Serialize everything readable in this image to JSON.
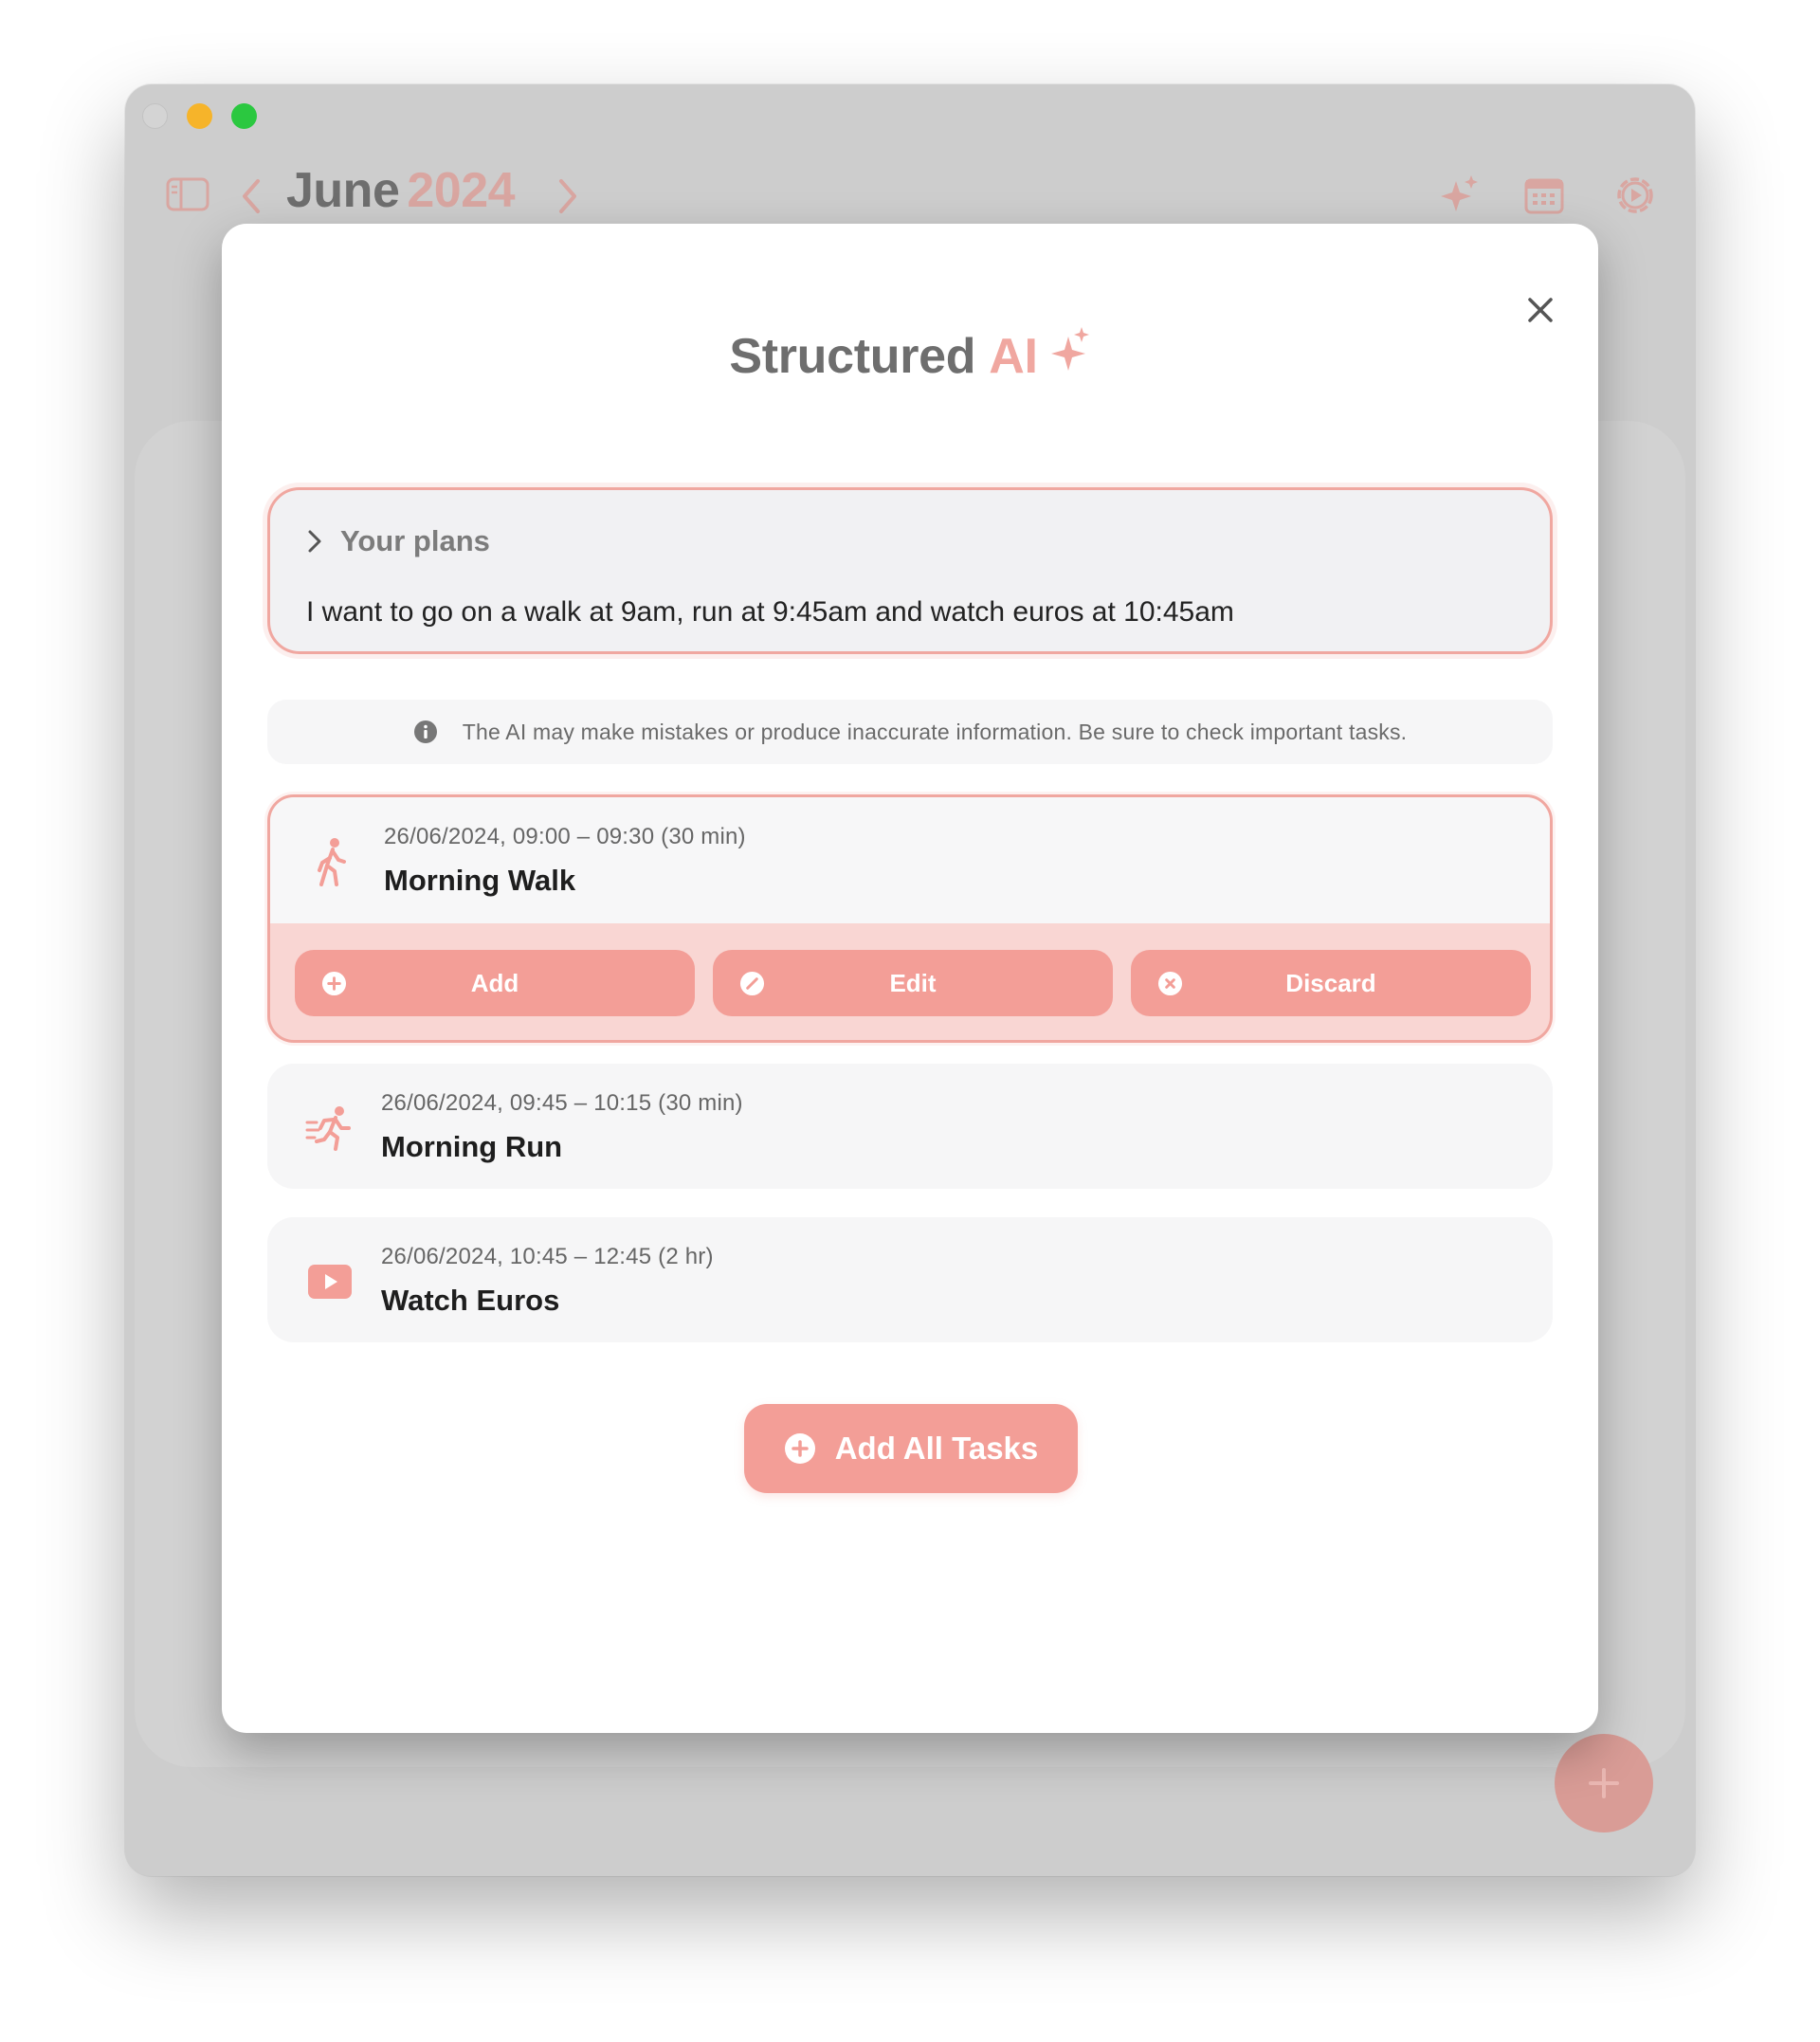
{
  "colors": {
    "accent": "#f39e97",
    "accent_light": "#f9d6d3",
    "title_gray": "#6e6e6e",
    "year_pink": "#d9a6a1"
  },
  "app": {
    "month": "June",
    "year": "2024",
    "icons": [
      "sidebar-toggle-icon",
      "chevron-left-icon",
      "chevron-right-icon",
      "sparkles-icon",
      "calendar-icon",
      "settings-icon",
      "plus-icon"
    ]
  },
  "modal": {
    "title": "Structured",
    "title_accent": "AI",
    "plans_label": "Your plans",
    "plans_text": "I want to go on a walk at 9am, run at 9:45am and watch euros at 10:45am",
    "disclaimer": "The AI may make mistakes or produce inaccurate information. Be sure to check important tasks.",
    "tasks": [
      {
        "time": "26/06/2024, 09:00 – 09:30 (30 min)",
        "name": "Morning Walk",
        "icon": "walking-icon",
        "selected": true
      },
      {
        "time": "26/06/2024, 09:45 – 10:15 (30 min)",
        "name": "Morning Run",
        "icon": "running-icon",
        "selected": false
      },
      {
        "time": "26/06/2024, 10:45 – 12:45 (2 hr)",
        "name": "Watch Euros",
        "icon": "play-video-icon",
        "selected": false
      }
    ],
    "actions": {
      "add": "Add",
      "edit": "Edit",
      "discard": "Discard"
    },
    "add_all": "Add All Tasks"
  }
}
